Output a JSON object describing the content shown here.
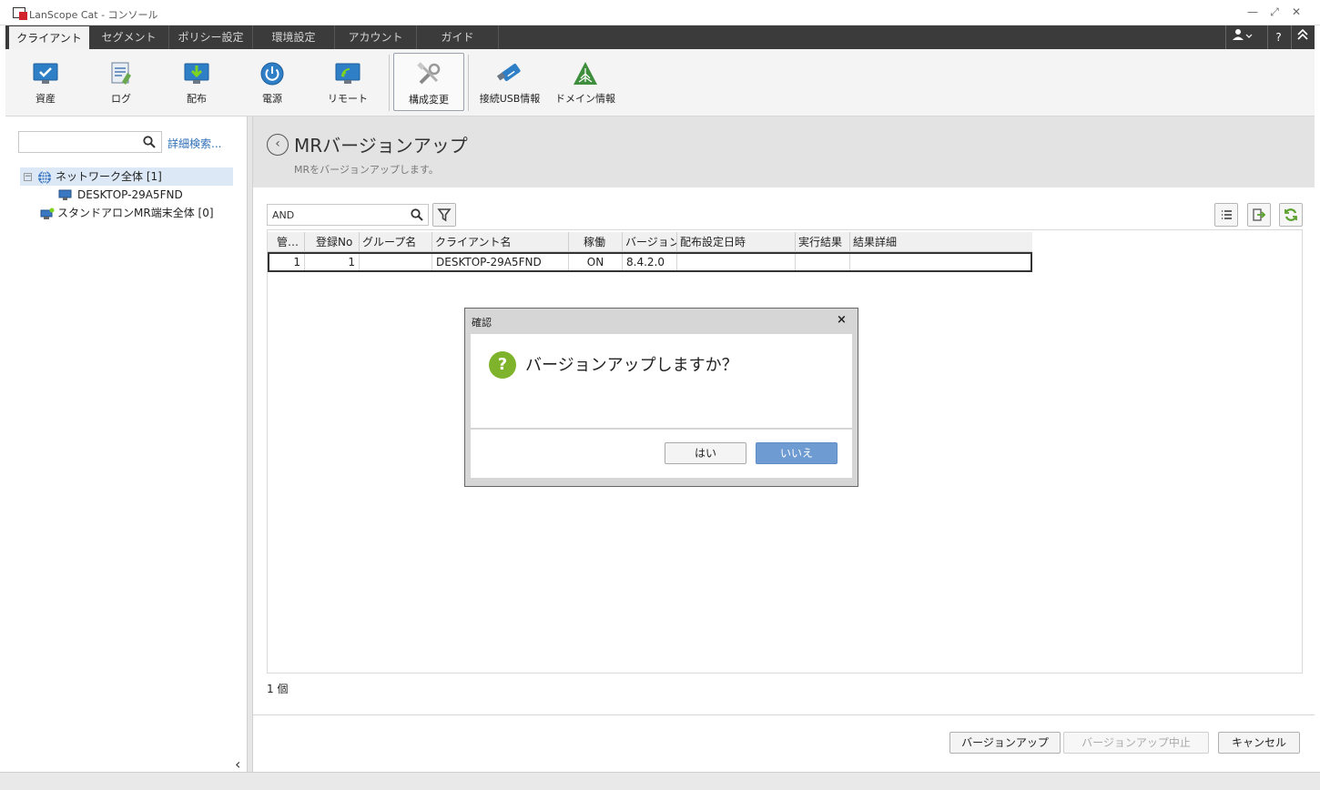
{
  "window": {
    "title": "LanScope Cat - コンソール"
  },
  "menu": {
    "tabs": [
      "クライアント",
      "セグメント",
      "ポリシー設定",
      "環境設定",
      "アカウント",
      "ガイド"
    ],
    "help": "?"
  },
  "toolbar": {
    "items": [
      {
        "label": "資産",
        "icon": "monitor-check-icon"
      },
      {
        "label": "ログ",
        "icon": "log-document-icon"
      },
      {
        "label": "配布",
        "icon": "download-icon"
      },
      {
        "label": "電源",
        "icon": "power-icon"
      },
      {
        "label": "リモート",
        "icon": "remote-icon"
      },
      {
        "label": "構成変更",
        "icon": "tools-icon"
      },
      {
        "label": "接続USB情報",
        "icon": "usb-icon"
      },
      {
        "label": "ドメイン情報",
        "icon": "domain-icon"
      }
    ]
  },
  "left": {
    "search_placeholder": "",
    "advanced_search": "詳細検索...",
    "tree": [
      {
        "label": "ネットワーク全体 [1]",
        "toggle": "−"
      },
      {
        "label": "DESKTOP-29A5FND"
      },
      {
        "label": "スタンドアロンMR端末全体 [0]"
      }
    ],
    "collapse": "‹"
  },
  "main": {
    "title": "MRバージョンアップ",
    "subtitle": "MRをバージョンアップします。",
    "filter_value": "AND",
    "grid": {
      "columns": [
        "管…",
        "登録No",
        "グループ名",
        "クライアント名",
        "稼働",
        "バージョン",
        "配布設定日時",
        "実行結果",
        "結果詳細"
      ],
      "rows": [
        [
          "1",
          "1",
          "",
          "DESKTOP-29A5FND",
          "ON",
          "8.4.2.0",
          "",
          "",
          ""
        ]
      ]
    },
    "count": "1 個",
    "buttons": {
      "upgrade": "バージョンアップ",
      "stop": "バージョンアップ中止",
      "cancel": "キャンセル"
    }
  },
  "dialog": {
    "title": "確認",
    "close": "×",
    "message": "バージョンアップしますか？",
    "yes": "はい",
    "no": "いいえ"
  },
  "colors": {
    "menu_bg": "#3b3b3b",
    "accent_button": "#6e9bd1",
    "question_icon": "#7fb32b",
    "link": "#2f6fb5"
  }
}
